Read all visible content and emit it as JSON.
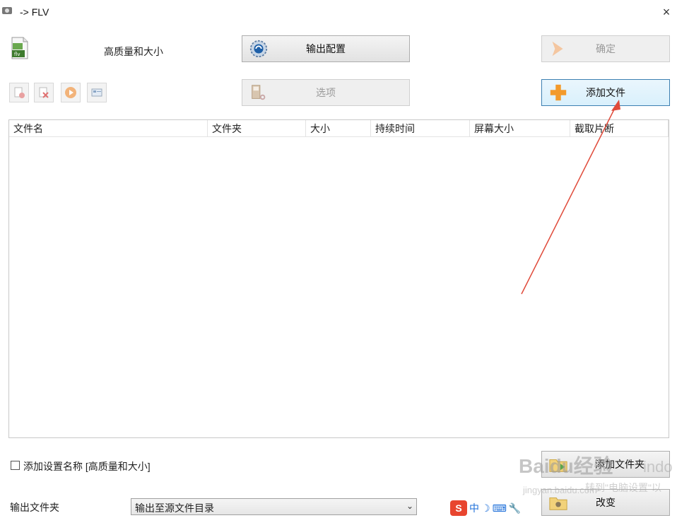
{
  "window": {
    "title": "-> FLV",
    "close": "×"
  },
  "profile": {
    "label": "高质量和大小",
    "format_badge": "flv"
  },
  "buttons": {
    "output_config": "输出配置",
    "ok": "确定",
    "options": "选项",
    "add_file": "添加文件",
    "add_folder": "添加文件夹",
    "change": "改变"
  },
  "file_list": {
    "columns": [
      "文件名",
      "文件夹",
      "大小",
      "持续时间",
      "屏幕大小",
      "截取片断"
    ],
    "rows": []
  },
  "settings": {
    "add_name_label": "添加设置名称 [高质量和大小]",
    "add_name_checked": false
  },
  "output": {
    "label": "输出文件夹",
    "selected": "输出至源文件目录"
  },
  "ime": {
    "logo": "S",
    "lang": "中",
    "moon": "☽",
    "keyboard": "⌨",
    "tool": "🔧"
  },
  "watermark": {
    "brand": "Baidu经验",
    "site": "jingyan.baidu.com",
    "text1": "indo",
    "text2": "转到\"电脑设置\"以"
  },
  "colors": {
    "accent_blue": "#3c7fb1",
    "plus_orange": "#f39a2b",
    "arrow_red": "#e04a3a"
  }
}
